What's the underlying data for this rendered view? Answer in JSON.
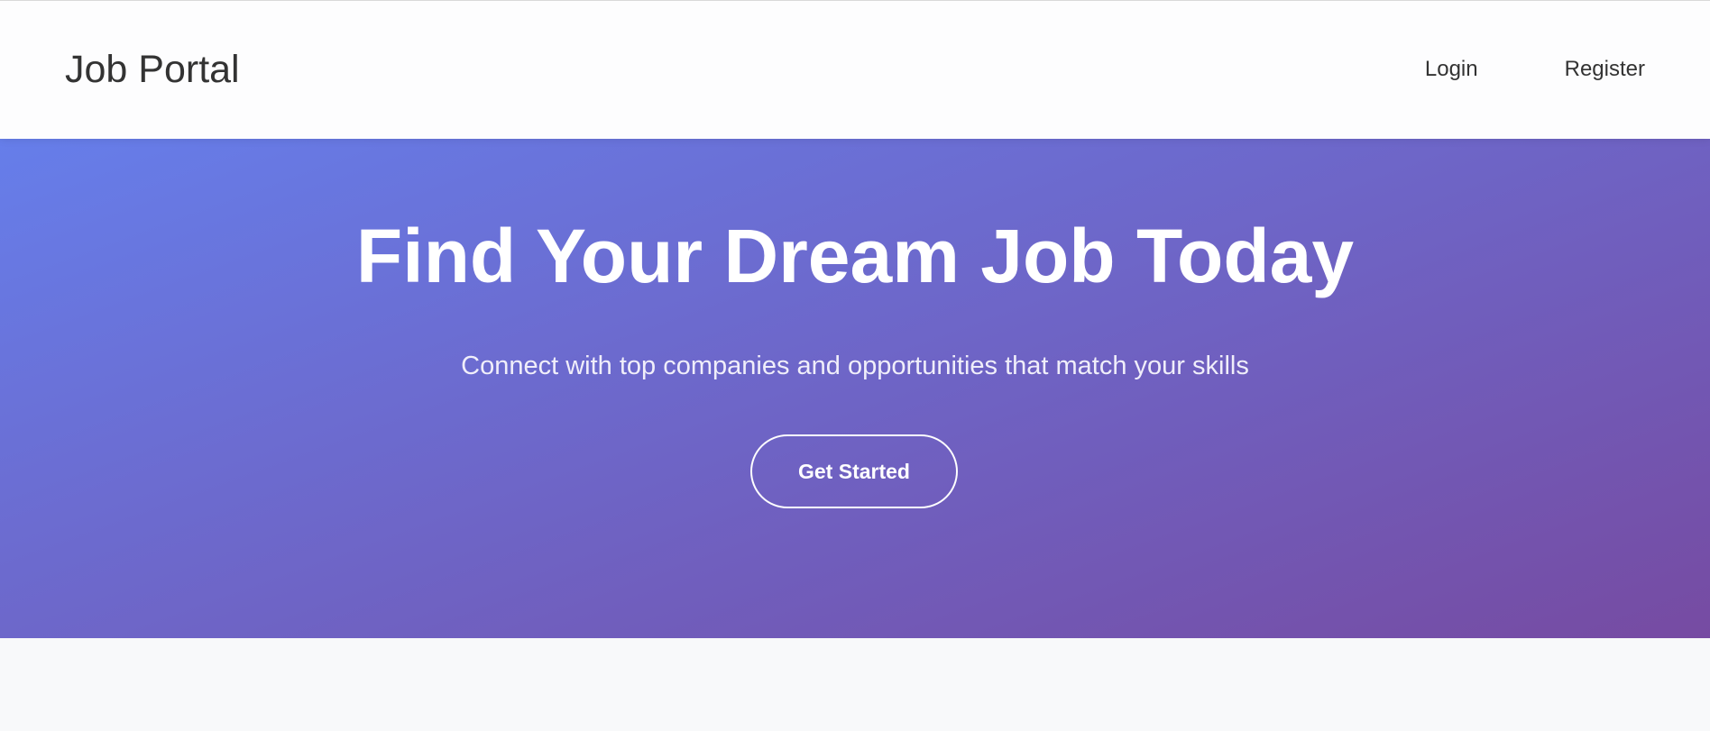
{
  "header": {
    "logo": "Job Portal",
    "nav": [
      {
        "label": "Login"
      },
      {
        "label": "Register"
      }
    ]
  },
  "hero": {
    "title": "Find Your Dream Job Today",
    "subtitle": "Connect with top companies and opportunities that match your skills",
    "cta_label": "Get Started",
    "gradient_start": "#667eea",
    "gradient_end": "#764ba2"
  },
  "colors": {
    "header_bg": "#fdfdfe",
    "text_dark": "#333333",
    "page_bg": "#f8f9fa"
  }
}
